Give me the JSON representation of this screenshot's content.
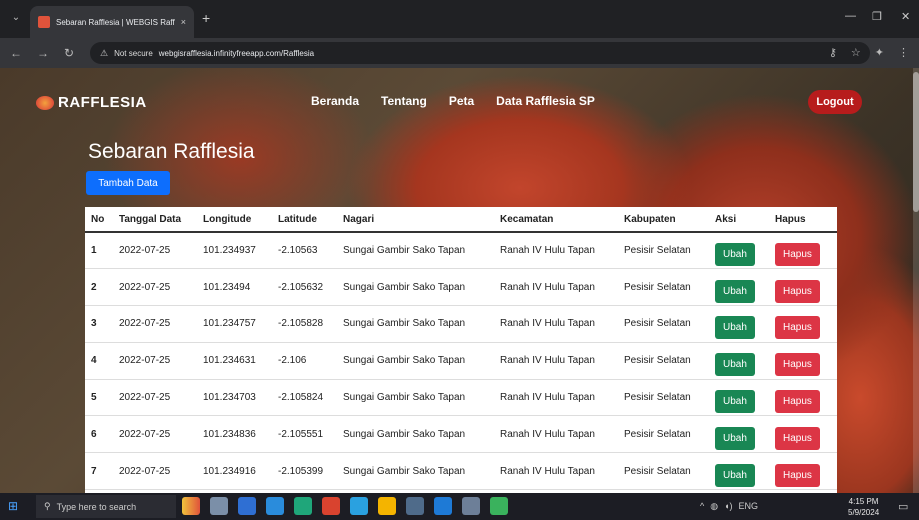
{
  "browser": {
    "tab_title": "Sebaran Rafflesia | WEBGIS Raffl",
    "tab_close": "×",
    "new_tab": "+",
    "security_label": "Not secure",
    "url": "webgisrafflesia.infinityfreeapp.com/Rafflesia"
  },
  "site": {
    "brand": "RAFFLESIA",
    "nav": [
      "Beranda",
      "Tentang",
      "Peta",
      "Data Rafflesia SP"
    ],
    "logout": "Logout",
    "page_title": "Sebaran Rafflesia",
    "add_button": "Tambah Data"
  },
  "table": {
    "headers": [
      "No",
      "Tanggal Data",
      "Longitude",
      "Latitude",
      "Nagari",
      "Kecamatan",
      "Kabupaten",
      "Aksi",
      "Hapus"
    ],
    "rows": [
      {
        "no": "1",
        "date": "2022-07-25",
        "lon": "101.234937",
        "lat": "-2.10563",
        "nagari": "Sungai Gambir Sako Tapan",
        "kec": "Ranah IV Hulu Tapan",
        "kab": "Pesisir Selatan"
      },
      {
        "no": "2",
        "date": "2022-07-25",
        "lon": "101.23494",
        "lat": "-2.105632",
        "nagari": "Sungai Gambir Sako Tapan",
        "kec": "Ranah IV Hulu Tapan",
        "kab": "Pesisir Selatan"
      },
      {
        "no": "3",
        "date": "2022-07-25",
        "lon": "101.234757",
        "lat": "-2.105828",
        "nagari": "Sungai Gambir Sako Tapan",
        "kec": "Ranah IV Hulu Tapan",
        "kab": "Pesisir Selatan"
      },
      {
        "no": "4",
        "date": "2022-07-25",
        "lon": "101.234631",
        "lat": "-2.106",
        "nagari": "Sungai Gambir Sako Tapan",
        "kec": "Ranah IV Hulu Tapan",
        "kab": "Pesisir Selatan"
      },
      {
        "no": "5",
        "date": "2022-07-25",
        "lon": "101.234703",
        "lat": "-2.105824",
        "nagari": "Sungai Gambir Sako Tapan",
        "kec": "Ranah IV Hulu Tapan",
        "kab": "Pesisir Selatan"
      },
      {
        "no": "6",
        "date": "2022-07-25",
        "lon": "101.234836",
        "lat": "-2.105551",
        "nagari": "Sungai Gambir Sako Tapan",
        "kec": "Ranah IV Hulu Tapan",
        "kab": "Pesisir Selatan"
      },
      {
        "no": "7",
        "date": "2022-07-25",
        "lon": "101.234916",
        "lat": "-2.105399",
        "nagari": "Sungai Gambir Sako Tapan",
        "kec": "Ranah IV Hulu Tapan",
        "kab": "Pesisir Selatan"
      }
    ],
    "ubah_label": "Ubah",
    "hapus_label": "Hapus"
  },
  "taskbar": {
    "search_placeholder": "Type here to search",
    "lang": "ENG",
    "time": "4:15 PM",
    "date": "5/9/2024"
  },
  "colors": {
    "primary": "#0d6efd",
    "success": "#198754",
    "danger": "#dc3545",
    "logout": "#b71c1c"
  }
}
